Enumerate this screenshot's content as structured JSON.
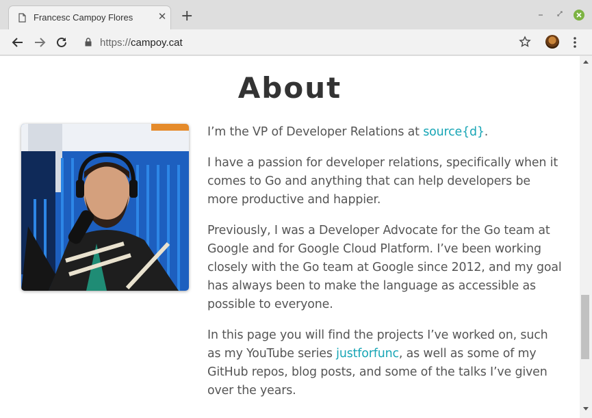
{
  "browser": {
    "tab": {
      "title": "Francesc Campoy Flores",
      "close_glyph": "✕"
    },
    "new_tab_glyph": "+",
    "address": {
      "scheme": "https://",
      "host": "campoy.cat"
    }
  },
  "page": {
    "title": "About",
    "paragraphs": [
      {
        "before": "I’m the VP of Developer Relations at ",
        "link": "source{d}",
        "after": "."
      },
      {
        "text": "I have a passion for developer relations, specifically when it comes to Go and anything that can help developers be more productive and happier."
      },
      {
        "text": "Previously, I was a Developer Advocate for the Go team at Google and for Google Cloud Platform. I’ve been working closely with the Go team at Google since 2012, and my goal has always been to make the language as accessible as possible to everyone."
      },
      {
        "before": "In this page you will find the projects I’ve worked on, such as my YouTube series ",
        "link": "justforfunc",
        "after": ", as well as some of my GitHub repos, blog posts, and some of the talks I’ve given over the years."
      }
    ]
  },
  "icons": [
    "page-icon",
    "close-icon",
    "plus-icon",
    "minimize-icon",
    "restore-icon",
    "window-close-icon",
    "back-arrow-icon",
    "forward-arrow-icon",
    "reload-icon",
    "lock-icon",
    "star-icon",
    "kebab-menu-icon"
  ],
  "colors": {
    "link": "#17a5b5",
    "body_text": "#555555",
    "heading": "#333333",
    "window_close": "#7cb342"
  }
}
